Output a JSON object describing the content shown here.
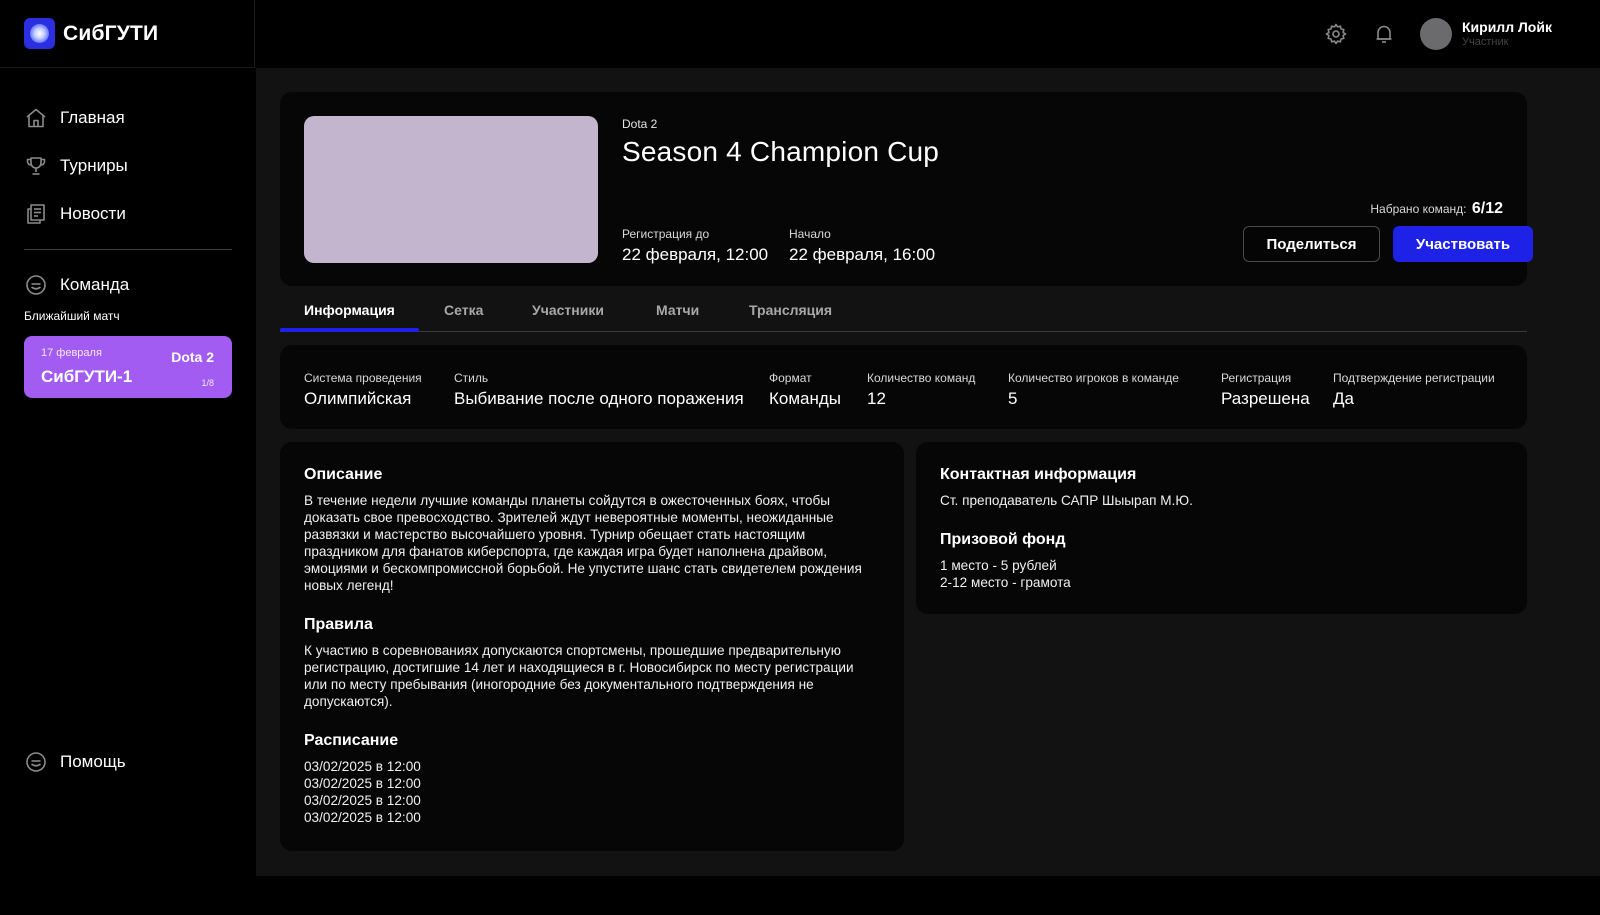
{
  "app": {
    "name": "СибГУТИ"
  },
  "sidebar": {
    "items": [
      {
        "label": "Главная",
        "icon": "home-icon"
      },
      {
        "label": "Турниры",
        "icon": "trophy-icon"
      },
      {
        "label": "Новости",
        "icon": "news-icon"
      },
      {
        "label": "Команда",
        "icon": "team-icon"
      }
    ],
    "nearest_match": {
      "title": "Ближайший матч",
      "date": "17 февраля",
      "game": "Dota 2",
      "team": "СибГУТИ-1",
      "round": "1/8",
      "color": "#a25cf2"
    },
    "help": {
      "label": "Помощь",
      "icon": "help-icon"
    }
  },
  "header": {
    "user": {
      "name": "Кирилл Лойк",
      "role": "Участник"
    }
  },
  "tournament": {
    "game": "Dota 2",
    "title": "Season 4 Champion Cup",
    "registration_label": "Регистрация до",
    "registration_value": "22 февраля, 12:00",
    "start_label": "Начало",
    "start_value": "22 февраля, 16:00",
    "teams_label": "Набрано команд:",
    "teams_value": "6/12",
    "share_label": "Поделиться",
    "join_label": "Участвовать",
    "accent": "#1d22e6"
  },
  "tabs": [
    {
      "label": "Информация",
      "active": true
    },
    {
      "label": "Сетка",
      "active": false
    },
    {
      "label": "Участники",
      "active": false
    },
    {
      "label": "Матчи",
      "active": false
    },
    {
      "label": "Трансляция",
      "active": false
    }
  ],
  "properties": [
    {
      "label": "Система проведения",
      "value": "Олимпийская"
    },
    {
      "label": "Стиль",
      "value": "Выбивание после одного поражения"
    },
    {
      "label": "Формат",
      "value": "Команды"
    },
    {
      "label": "Количество команд",
      "value": "12"
    },
    {
      "label": "Количество игроков в команде",
      "value": "5"
    },
    {
      "label": "Регистрация",
      "value": "Разрешена"
    },
    {
      "label": "Подтверждение регистрации",
      "value": "Да"
    }
  ],
  "description": {
    "title": "Описание",
    "text": "В течение недели лучшие команды планеты сойдутся в ожесточенных боях, чтобы доказать свое превосходство. Зрителей ждут невероятные моменты, неожиданные развязки и мастерство высочайшего уровня. Турнир обещает стать настоящим праздником для фанатов киберспорта, где каждая игра будет наполнена драйвом, эмоциями и бескомпромиссной борьбой. Не упустите шанс стать свидетелем рождения новых легенд!"
  },
  "rules": {
    "title": "Правила",
    "text": "К участию в соревнованиях допускаются спортсмены, прошедшие предварительную регистрацию, достигшие 14 лет и находящиеся в г. Новосибирск по месту регистрации или по месту пребывания (иногородние без документального подтверждения не допускаются)."
  },
  "schedule": {
    "title": "Расписание",
    "items": [
      "03/02/2025 в 12:00",
      "03/02/2025 в 12:00",
      "03/02/2025 в 12:00",
      "03/02/2025 в 12:00"
    ]
  },
  "contacts": {
    "title": "Контактная информация",
    "text": "Ст. преподаватель САПР Шыырап М.Ю."
  },
  "prize": {
    "title": "Призовой фонд",
    "items": [
      "1 место - 5 рублей",
      "2-12 место - грамота"
    ]
  }
}
